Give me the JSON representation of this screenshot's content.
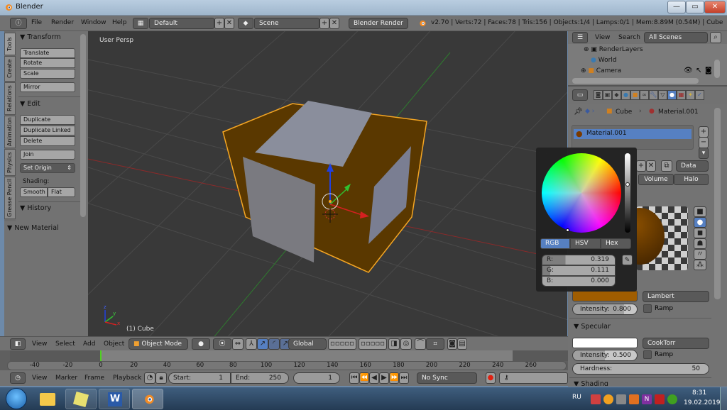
{
  "window": {
    "title": "Blender",
    "minimize": "—",
    "maximize": "▭",
    "close": "✕"
  },
  "menubar": {
    "items": [
      "File",
      "Render",
      "Window",
      "Help"
    ],
    "layout": "Default",
    "scene": "Scene",
    "engine": "Blender Render",
    "info": "v2.70 | Verts:72 | Faces:78 | Tris:156 | Objects:1/4 | Lamps:0/1 | Mem:8.89M (0.54M) | Cube"
  },
  "toolshelf": {
    "tabs": [
      "Tools",
      "Create",
      "Relations",
      "Animation",
      "Physics",
      "Grease Pencil"
    ],
    "transform": {
      "title": "Transform",
      "buttons": [
        "Translate",
        "Rotate",
        "Scale",
        "Mirror"
      ]
    },
    "edit": {
      "title": "Edit",
      "buttons": [
        "Duplicate",
        "Duplicate Linked",
        "Delete",
        "Join"
      ],
      "set_origin": "Set Origin",
      "shading_label": "Shading:",
      "smooth": "Smooth",
      "flat": "Flat"
    },
    "history": {
      "title": "History"
    },
    "new_material": "New Material"
  },
  "viewport": {
    "view_label": "User Persp",
    "object_label": "(1) Cube",
    "axes": {
      "x": "x",
      "y": "y",
      "z": "z"
    },
    "colors": {
      "frame": "#6b4200",
      "panel": "#8a8e9c",
      "outline": "#f5a623",
      "x_axis": "#d42020",
      "y_axis": "#30c030",
      "z_axis": "#2040e0"
    }
  },
  "viewport_header": {
    "menus": [
      "View",
      "Select",
      "Add",
      "Object"
    ],
    "mode": "Object Mode",
    "orientation": "Global"
  },
  "timeline": {
    "ticks": [
      "-40",
      "-20",
      "0",
      "20",
      "40",
      "60",
      "80",
      "100",
      "120",
      "140",
      "160",
      "180",
      "200",
      "220",
      "240",
      "260"
    ],
    "current_frame_marker": 0,
    "menus": [
      "View",
      "Marker",
      "Frame",
      "Playback"
    ],
    "start_label": "Start:",
    "start": "1",
    "end_label": "End:",
    "end": "250",
    "current": "1",
    "sync": "No Sync"
  },
  "outliner": {
    "menus": [
      "View",
      "Search"
    ],
    "filter": "All Scenes",
    "items": [
      "RenderLayers",
      "World",
      "Camera"
    ]
  },
  "properties": {
    "breadcrumb": [
      "Cube",
      "Material.001"
    ],
    "material_slot": "Material.001",
    "data_dropdown": "Data",
    "tabs": [
      "Volume",
      "Halo"
    ],
    "diffuse": {
      "shader": "Lambert",
      "intensity_label": "Intensity:",
      "intensity": "0.800",
      "ramp": "Ramp",
      "color": "#a05d00"
    },
    "specular": {
      "title": "Specular",
      "shader": "CookTorr",
      "intensity_label": "Intensity:",
      "intensity": "0.500",
      "ramp": "Ramp",
      "hardness_label": "Hardness:",
      "hardness": "50",
      "color": "#ffffff"
    },
    "shading_title": "Shading"
  },
  "color_picker": {
    "tabs": [
      "RGB",
      "HSV",
      "Hex"
    ],
    "active_tab": "RGB",
    "r_label": "R:",
    "r": "0.319",
    "g_label": "G:",
    "g": "0.111",
    "b_label": "B:",
    "b": "0.000"
  },
  "taskbar": {
    "lang": "RU",
    "time": "8:31",
    "date": "19.02.2019",
    "apps": [
      "windows-start",
      "file-explorer",
      "sticky-notes",
      "word",
      "blender"
    ]
  }
}
